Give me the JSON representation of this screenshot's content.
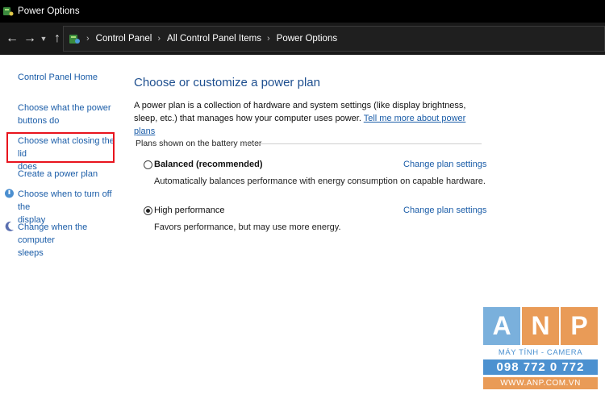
{
  "window": {
    "title": "Power Options",
    "icon": "power-options-icon"
  },
  "address_bar": {
    "back_icon": "arrow-left-icon",
    "forward_icon": "arrow-right-icon",
    "recent_icon": "chevron-down-icon",
    "up_icon": "arrow-up-icon",
    "breadcrumbs": [
      "Control Panel",
      "All Control Panel Items",
      "Power Options"
    ]
  },
  "sidebar": {
    "home": "Control Panel Home",
    "tasks": [
      {
        "label_line1": "Choose what the power",
        "label_line2": "buttons do"
      },
      {
        "label_line1": "Choose what closing the lid",
        "label_line2": "does",
        "highlighted": true
      },
      {
        "label_line1": "Create a power plan"
      },
      {
        "label_line1": "Choose when to turn off the",
        "label_line2": "display",
        "icon": "display-icon"
      },
      {
        "label_line1": "Change when the computer",
        "label_line2": "sleeps",
        "icon": "moon-icon"
      }
    ]
  },
  "main": {
    "heading": "Choose or customize a power plan",
    "description": "A power plan is a collection of hardware and system settings (like display brightness, sleep, etc.) that manages how your computer uses power.",
    "description_link": "Tell me more about power plans",
    "group_label": "Plans shown on the battery meter",
    "plans": [
      {
        "name": "Balanced (recommended)",
        "description": "Automatically balances performance with energy consumption on capable hardware.",
        "selected": false,
        "link": "Change plan settings"
      },
      {
        "name": "High performance",
        "description": "Favors performance, but may use more energy.",
        "selected": true,
        "link": "Change plan settings"
      }
    ]
  },
  "watermark": {
    "letters": [
      "A",
      "N",
      "P"
    ],
    "tagline": "MÁY TÍNH - CAMERA",
    "phone": "098 772 0 772",
    "site": "WWW.ANP.COM.VN"
  },
  "colors": {
    "link": "#1b5da8",
    "heading": "#1e4f8f",
    "highlight": "#e8141d"
  }
}
